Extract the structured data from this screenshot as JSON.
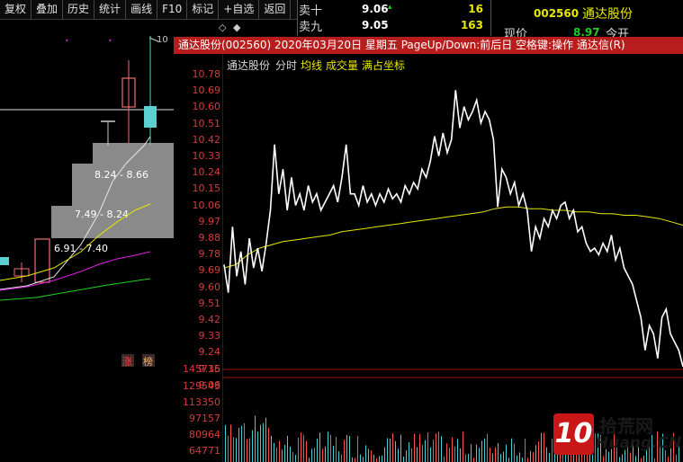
{
  "toolbar": {
    "buttons": [
      "复权",
      "叠加",
      "历史",
      "统计",
      "画线",
      "F10",
      "标记",
      "+自选",
      "返回"
    ]
  },
  "order_book": {
    "rows": [
      {
        "label": "卖十",
        "price": "9.06",
        "vol": "16"
      },
      {
        "label": "卖九",
        "price": "9.05",
        "vol": "163"
      }
    ],
    "stock_code": "002560",
    "stock_name": "通达股份",
    "price_label": "现价",
    "price_value": "8.97",
    "open_label": "今开"
  },
  "kline_panel": {
    "top_marker": "10",
    "chip_labels": [
      "8.24 - 8.66",
      "7.49 - 8.24",
      "6.91 - 7.40"
    ],
    "badges": [
      "涨",
      "榜"
    ]
  },
  "popup": {
    "title": "通达股份(002560) 2020年03月20日 星期五 PageUp/Down:前后日 空格键:操作 通达信(R)",
    "legend": {
      "name": "通达股份",
      "type": "分时",
      "avg": "均线",
      "vol": "成交量",
      "coord": "满占坐标"
    },
    "colors": {
      "price": "#ffffff",
      "avg": "#e8e800",
      "axis": "#d83a3a",
      "title_bg": "#b81d1d"
    },
    "volume_axis": [
      "145736",
      "129543",
      "113350",
      "97157",
      "80964",
      "64771"
    ]
  },
  "chart_data": {
    "type": "line",
    "yticks": [
      "10.78",
      "10.69",
      "10.60",
      "10.51",
      "10.42",
      "10.33",
      "10.24",
      "10.15",
      "10.06",
      "9.97",
      "9.88",
      "9.78",
      "9.69",
      "9.60",
      "9.51",
      "9.42",
      "9.33",
      "9.24",
      "9.15",
      "9.06"
    ],
    "ylim": [
      9.0,
      10.78
    ],
    "series": [
      {
        "values": [
          9.62,
          9.45,
          9.85,
          9.55,
          9.7,
          9.5,
          9.78,
          9.6,
          9.72,
          9.58,
          9.75,
          9.95,
          10.35,
          10.05,
          10.2,
          9.95,
          10.15,
          9.98,
          10.05,
          9.95,
          10.1,
          10.0,
          10.05,
          9.95,
          10.0,
          10.05,
          10.1,
          10.0,
          10.15,
          10.35,
          10.05,
          10.05,
          9.98,
          10.1,
          10.0,
          10.05,
          9.98,
          10.05,
          10.0,
          10.08,
          10.02,
          10.05,
          10.0,
          10.1,
          10.05,
          10.12,
          10.08,
          10.2,
          10.15,
          10.25,
          10.4,
          10.28,
          10.42,
          10.3,
          10.38,
          10.68,
          10.45,
          10.58,
          10.5,
          10.55,
          10.62,
          10.48,
          10.55,
          10.5,
          10.38,
          9.97,
          10.2,
          10.15,
          10.05,
          10.12,
          9.98,
          10.05,
          9.95,
          9.7,
          9.85,
          9.78,
          9.9,
          9.85,
          9.95,
          9.9,
          9.98,
          10.0,
          9.9,
          9.95,
          9.82,
          9.85,
          9.75,
          9.7,
          9.72,
          9.68,
          9.75,
          9.7,
          9.8,
          9.65,
          9.72,
          9.6,
          9.55,
          9.5,
          9.4,
          9.3,
          9.1,
          9.25,
          9.2,
          9.05,
          9.3,
          9.35,
          9.2,
          9.15,
          9.1,
          9.0
        ]
      },
      {
        "values": [
          9.6,
          9.62,
          9.68,
          9.72,
          9.74,
          9.76,
          9.77,
          9.78,
          9.79,
          9.8,
          9.82,
          9.83,
          9.84,
          9.85,
          9.86,
          9.87,
          9.88,
          9.89,
          9.9,
          9.91,
          9.92,
          9.93,
          9.94,
          9.96,
          9.97,
          9.97,
          9.96,
          9.96,
          9.95,
          9.95,
          9.94,
          9.94,
          9.93,
          9.93,
          9.92,
          9.92,
          9.91,
          9.9,
          9.88,
          9.86
        ]
      }
    ]
  }
}
